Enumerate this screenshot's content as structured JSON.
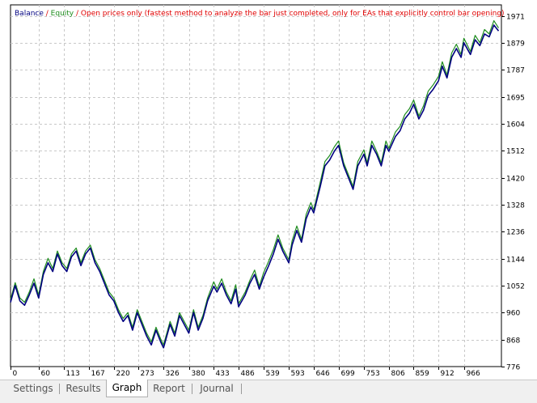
{
  "legend": {
    "balance": "Balance",
    "sep1": " / ",
    "equity": "Equity",
    "sep2": " / ",
    "note": "Open prices only (fastest method to analyze the bar just completed, only for EAs that explicitly control bar opening)"
  },
  "colors": {
    "balance": "#000080",
    "equity": "#1e8c1e",
    "note": "#e00000",
    "grid": "#c8c8c8"
  },
  "tabs": [
    {
      "label": "Settings",
      "active": false
    },
    {
      "label": "Results",
      "active": false
    },
    {
      "label": "Graph",
      "active": true
    },
    {
      "label": "Report",
      "active": false
    },
    {
      "label": "Journal",
      "active": false
    }
  ],
  "chart_data": {
    "type": "line",
    "title": "",
    "xlabel": "",
    "ylabel": "",
    "xlim": [
      0,
      1046
    ],
    "ylim": [
      776,
      2009
    ],
    "grid": true,
    "legend_position": "top-left",
    "y_ticks": [
      776,
      868,
      960,
      1052,
      1144,
      1236,
      1328,
      1420,
      1512,
      1604,
      1695,
      1787,
      1879,
      1971
    ],
    "x_ticks": [
      0,
      60,
      113,
      167,
      220,
      273,
      326,
      380,
      433,
      486,
      539,
      593,
      646,
      699,
      753,
      806,
      859,
      912,
      966
    ],
    "series": [
      {
        "name": "Balance",
        "color": "#000080",
        "x": [
          0,
          10,
          20,
          30,
          40,
          50,
          60,
          70,
          80,
          90,
          100,
          110,
          120,
          130,
          140,
          150,
          160,
          170,
          180,
          190,
          200,
          210,
          220,
          230,
          240,
          250,
          260,
          270,
          280,
          290,
          300,
          310,
          320,
          326,
          340,
          350,
          360,
          370,
          380,
          390,
          400,
          410,
          420,
          433,
          440,
          450,
          460,
          470,
          480,
          486,
          500,
          510,
          520,
          530,
          539,
          550,
          560,
          570,
          580,
          593,
          600,
          610,
          620,
          630,
          640,
          646,
          660,
          670,
          680,
          690,
          699,
          710,
          720,
          730,
          740,
          753,
          760,
          770,
          780,
          790,
          800,
          806,
          820,
          830,
          840,
          850,
          859,
          870,
          880,
          890,
          900,
          912,
          920,
          930,
          940,
          950,
          960,
          966,
          980,
          990,
          1000,
          1010,
          1020,
          1030,
          1040
        ],
        "values": [
          995,
          1052,
          1000,
          985,
          1020,
          1060,
          1010,
          1090,
          1130,
          1100,
          1160,
          1120,
          1100,
          1150,
          1170,
          1120,
          1160,
          1180,
          1130,
          1100,
          1060,
          1020,
          1000,
          960,
          930,
          950,
          900,
          960,
          920,
          880,
          850,
          900,
          860,
          840,
          920,
          880,
          950,
          920,
          890,
          960,
          900,
          940,
          1000,
          1050,
          1030,
          1060,
          1020,
          990,
          1040,
          980,
          1020,
          1060,
          1090,
          1040,
          1080,
          1120,
          1160,
          1210,
          1170,
          1130,
          1190,
          1240,
          1200,
          1280,
          1320,
          1300,
          1390,
          1460,
          1480,
          1510,
          1530,
          1460,
          1420,
          1380,
          1460,
          1500,
          1460,
          1530,
          1500,
          1460,
          1530,
          1510,
          1560,
          1580,
          1620,
          1640,
          1670,
          1620,
          1650,
          1700,
          1720,
          1750,
          1800,
          1760,
          1830,
          1860,
          1830,
          1880,
          1840,
          1890,
          1870,
          1910,
          1900,
          1940,
          1920
        ]
      },
      {
        "name": "Equity",
        "color": "#1e8c1e",
        "x": [
          0,
          10,
          20,
          30,
          40,
          50,
          60,
          70,
          80,
          90,
          100,
          110,
          120,
          130,
          140,
          150,
          160,
          170,
          180,
          190,
          200,
          210,
          220,
          230,
          240,
          250,
          260,
          270,
          280,
          290,
          300,
          310,
          320,
          326,
          340,
          350,
          360,
          370,
          380,
          390,
          400,
          410,
          420,
          433,
          440,
          450,
          460,
          470,
          480,
          486,
          500,
          510,
          520,
          530,
          539,
          550,
          560,
          570,
          580,
          593,
          600,
          610,
          620,
          630,
          640,
          646,
          660,
          670,
          680,
          690,
          699,
          710,
          720,
          730,
          740,
          753,
          760,
          770,
          780,
          790,
          800,
          806,
          820,
          830,
          840,
          850,
          859,
          870,
          880,
          890,
          900,
          912,
          920,
          930,
          940,
          950,
          960,
          966,
          980,
          990,
          1000,
          1010,
          1020,
          1030,
          1040
        ],
        "values": [
          1005,
          1062,
          1010,
          995,
          1030,
          1075,
          1020,
          1100,
          1145,
          1110,
          1170,
          1130,
          1110,
          1160,
          1180,
          1130,
          1170,
          1190,
          1140,
          1110,
          1070,
          1030,
          1010,
          970,
          940,
          960,
          910,
          970,
          930,
          890,
          860,
          910,
          870,
          850,
          930,
          890,
          960,
          930,
          900,
          970,
          910,
          950,
          1010,
          1065,
          1040,
          1075,
          1030,
          1000,
          1055,
          990,
          1030,
          1070,
          1105,
          1050,
          1095,
          1135,
          1175,
          1225,
          1180,
          1140,
          1205,
          1255,
          1210,
          1295,
          1335,
          1310,
          1405,
          1475,
          1495,
          1525,
          1545,
          1470,
          1430,
          1390,
          1475,
          1515,
          1470,
          1545,
          1510,
          1470,
          1545,
          1520,
          1575,
          1595,
          1635,
          1655,
          1685,
          1630,
          1665,
          1715,
          1735,
          1765,
          1815,
          1770,
          1845,
          1875,
          1840,
          1895,
          1850,
          1905,
          1880,
          1925,
          1910,
          1955,
          1930
        ]
      }
    ]
  }
}
